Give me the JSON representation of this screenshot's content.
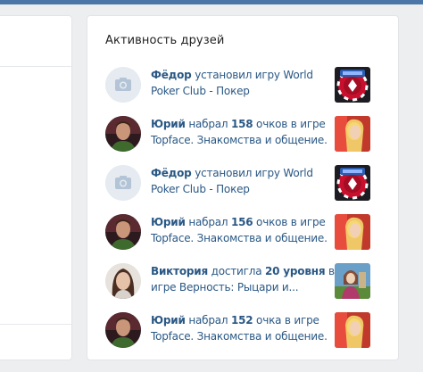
{
  "widget": {
    "title": "Активность друзей"
  },
  "feed": [
    {
      "name": "Фёдор",
      "action_before": " установил игру ",
      "number": "",
      "action_after": "World Poker Club - Покер",
      "avatar": "camera-placeholder-icon",
      "game": "poker"
    },
    {
      "name": "Юрий",
      "action_before": " набрал ",
      "number": "158",
      "action_after": " очков в игре Topface. Знакомства и общение.",
      "avatar": "user-photo",
      "game": "topface"
    },
    {
      "name": "Фёдор",
      "action_before": " установил игру ",
      "number": "",
      "action_after": "World Poker Club - Покер",
      "avatar": "camera-placeholder-icon",
      "game": "poker"
    },
    {
      "name": "Юрий",
      "action_before": " набрал ",
      "number": "156",
      "action_after": " очков в игре Topface. Знакомства и общение.",
      "avatar": "user-photo",
      "game": "topface"
    },
    {
      "name": "Виктория",
      "action_before": " достигла ",
      "number": "20 уровня",
      "action_after": " в игре Верность: Рыцари и...",
      "avatar": "user-photo",
      "game": "vernost"
    },
    {
      "name": "Юрий",
      "action_before": " набрал ",
      "number": "152",
      "action_after": " очка в игре Topface. Знакомства и общение.",
      "avatar": "user-photo",
      "game": "topface"
    }
  ],
  "colors": {
    "header_bar": "#4a76a8",
    "link": "#2a5885",
    "background": "#edeef0"
  }
}
